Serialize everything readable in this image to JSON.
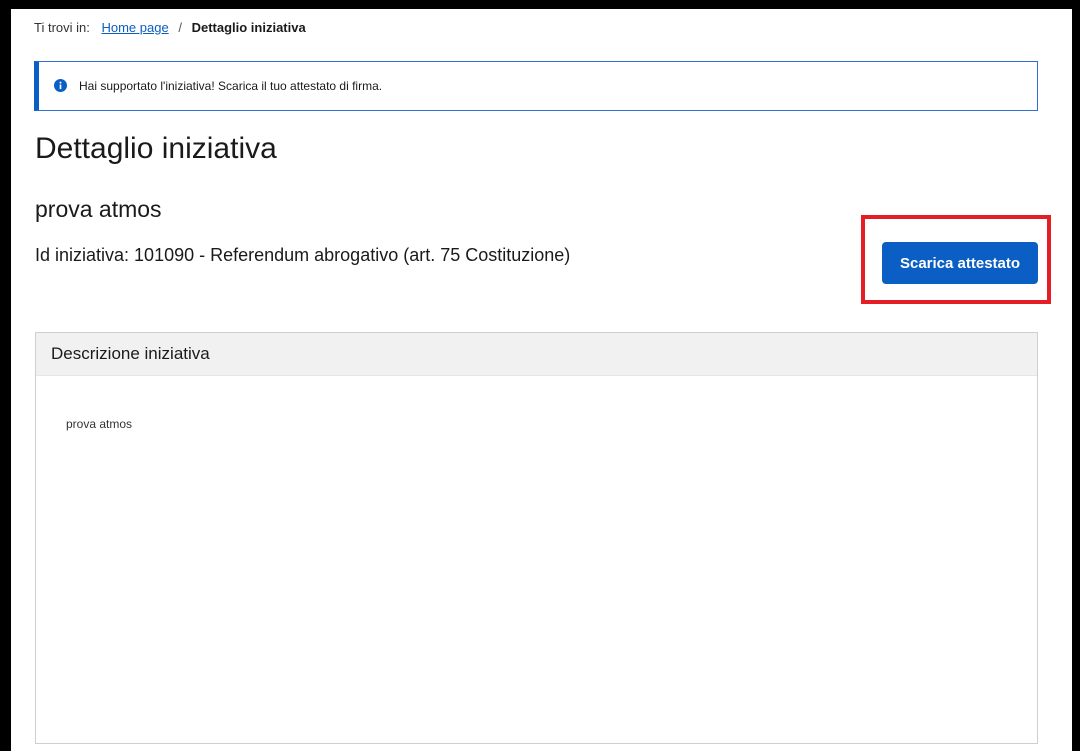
{
  "breadcrumb": {
    "prefix": "Ti trovi in:",
    "home_link": "Home page",
    "separator": "/",
    "current": "Dettaglio iniziativa"
  },
  "alert": {
    "icon": "info-icon",
    "message": "Hai supportato l'iniziativa! Scarica il tuo attestato di firma."
  },
  "page": {
    "title": "Dettaglio iniziativa",
    "initiative_name": "prova atmos",
    "initiative_meta": "Id iniziativa: 101090 - Referendum abrogativo (art. 75 Costituzione)"
  },
  "actions": {
    "download_label": "Scarica attestato"
  },
  "description_card": {
    "title": "Descrizione iniziativa",
    "body": "prova atmos"
  },
  "colors": {
    "primary": "#0b5fc4",
    "highlight": "#e31e24",
    "card_header_bg": "#f1f1f1"
  }
}
